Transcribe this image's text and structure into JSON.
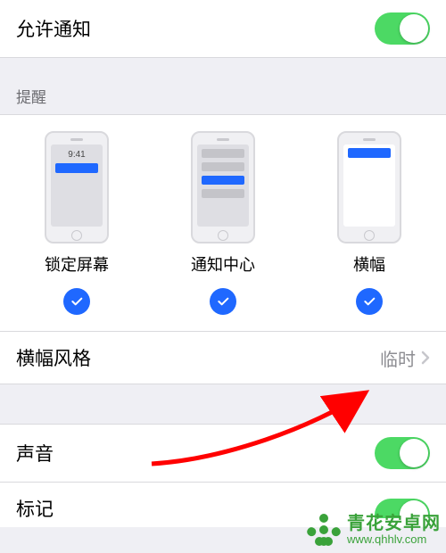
{
  "allowNotifications": {
    "label": "允许通知",
    "on": true
  },
  "alertsHeader": "提醒",
  "alertStyles": [
    {
      "label": "锁定屏幕",
      "checked": true,
      "lockTime": "9:41"
    },
    {
      "label": "通知中心",
      "checked": true
    },
    {
      "label": "横幅",
      "checked": true
    }
  ],
  "bannerStyle": {
    "label": "横幅风格",
    "value": "临时"
  },
  "sound": {
    "label": "声音",
    "on": true
  },
  "badge": {
    "label": "标记",
    "on": true
  },
  "colors": {
    "accent": "#1f68ff",
    "toggleOn": "#4cd964",
    "arrow": "#ff0000",
    "brand": "#3aa23a"
  },
  "watermark": {
    "name": "青花安卓网",
    "url": "www.qhhlv.com"
  }
}
